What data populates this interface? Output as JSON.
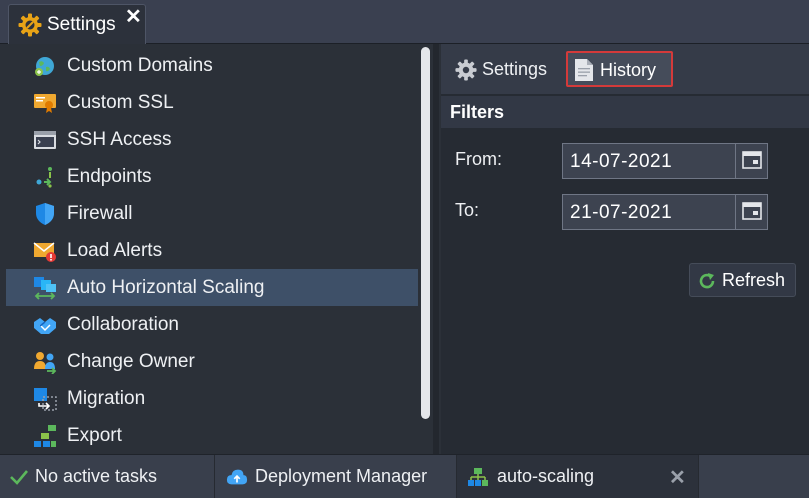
{
  "window": {
    "tab_title": "Settings",
    "close_glyph": "✕",
    "accent_color": "#e8a317"
  },
  "sidebar": {
    "items": [
      {
        "label": "Custom Domains",
        "icon": "globe-icon"
      },
      {
        "label": "Custom SSL",
        "icon": "certificate-icon"
      },
      {
        "label": "SSH Access",
        "icon": "terminal-icon"
      },
      {
        "label": "Endpoints",
        "icon": "endpoints-icon"
      },
      {
        "label": "Firewall",
        "icon": "shield-icon"
      },
      {
        "label": "Load Alerts",
        "icon": "alert-mail-icon"
      },
      {
        "label": "Auto Horizontal Scaling",
        "icon": "scaling-icon",
        "selected": true
      },
      {
        "label": "Collaboration",
        "icon": "handshake-icon"
      },
      {
        "label": "Change Owner",
        "icon": "change-owner-icon"
      },
      {
        "label": "Migration",
        "icon": "migration-icon"
      },
      {
        "label": "Export",
        "icon": "export-icon"
      }
    ]
  },
  "panel": {
    "tabs": [
      {
        "label": "Settings",
        "icon": "gear-icon"
      },
      {
        "label": "History",
        "icon": "document-icon",
        "active": true
      }
    ],
    "filters": {
      "title": "Filters",
      "from_label": "From:",
      "from_value": "14-07-2021",
      "to_label": "To:",
      "to_value": "21-07-2021"
    },
    "refresh_label": "Refresh"
  },
  "taskbar": {
    "status": "No active tasks",
    "deployment_manager": "Deployment Manager",
    "active_tab": "auto-scaling",
    "close_glyph": "✕"
  }
}
